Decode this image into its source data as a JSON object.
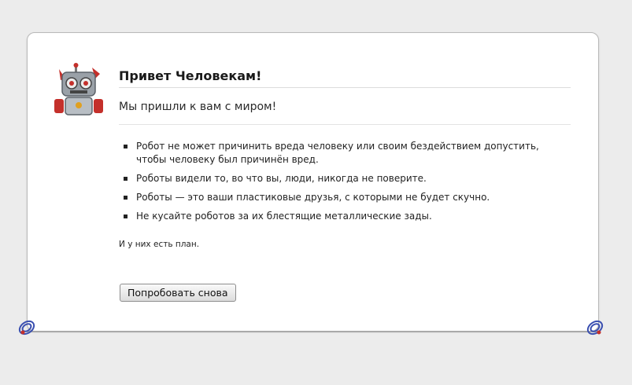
{
  "header": {
    "title": "Привет Человекам!",
    "subtitle": "Мы пришли к вам с миром!"
  },
  "laws": [
    "Робот не может причинить вреда человеку или своим бездействием допустить, чтобы человеку был причинён вред.",
    "Роботы видели то, во что вы, люди, никогда не поверите.",
    "Роботы — это ваши пластиковые друзья, с которыми не будет скучно.",
    "Не кусайте роботов за их блестящие металлические зады."
  ],
  "footer_note": "И у них есть план.",
  "actions": {
    "retry_label": "Попробовать снова"
  },
  "icons": {
    "mascot": "robot-icon",
    "decoration": "swirl-icon"
  },
  "colors": {
    "background": "#ececec",
    "card": "#ffffff",
    "robot_red": "#c4302b",
    "swirl_blue": "#3a4fb0"
  }
}
